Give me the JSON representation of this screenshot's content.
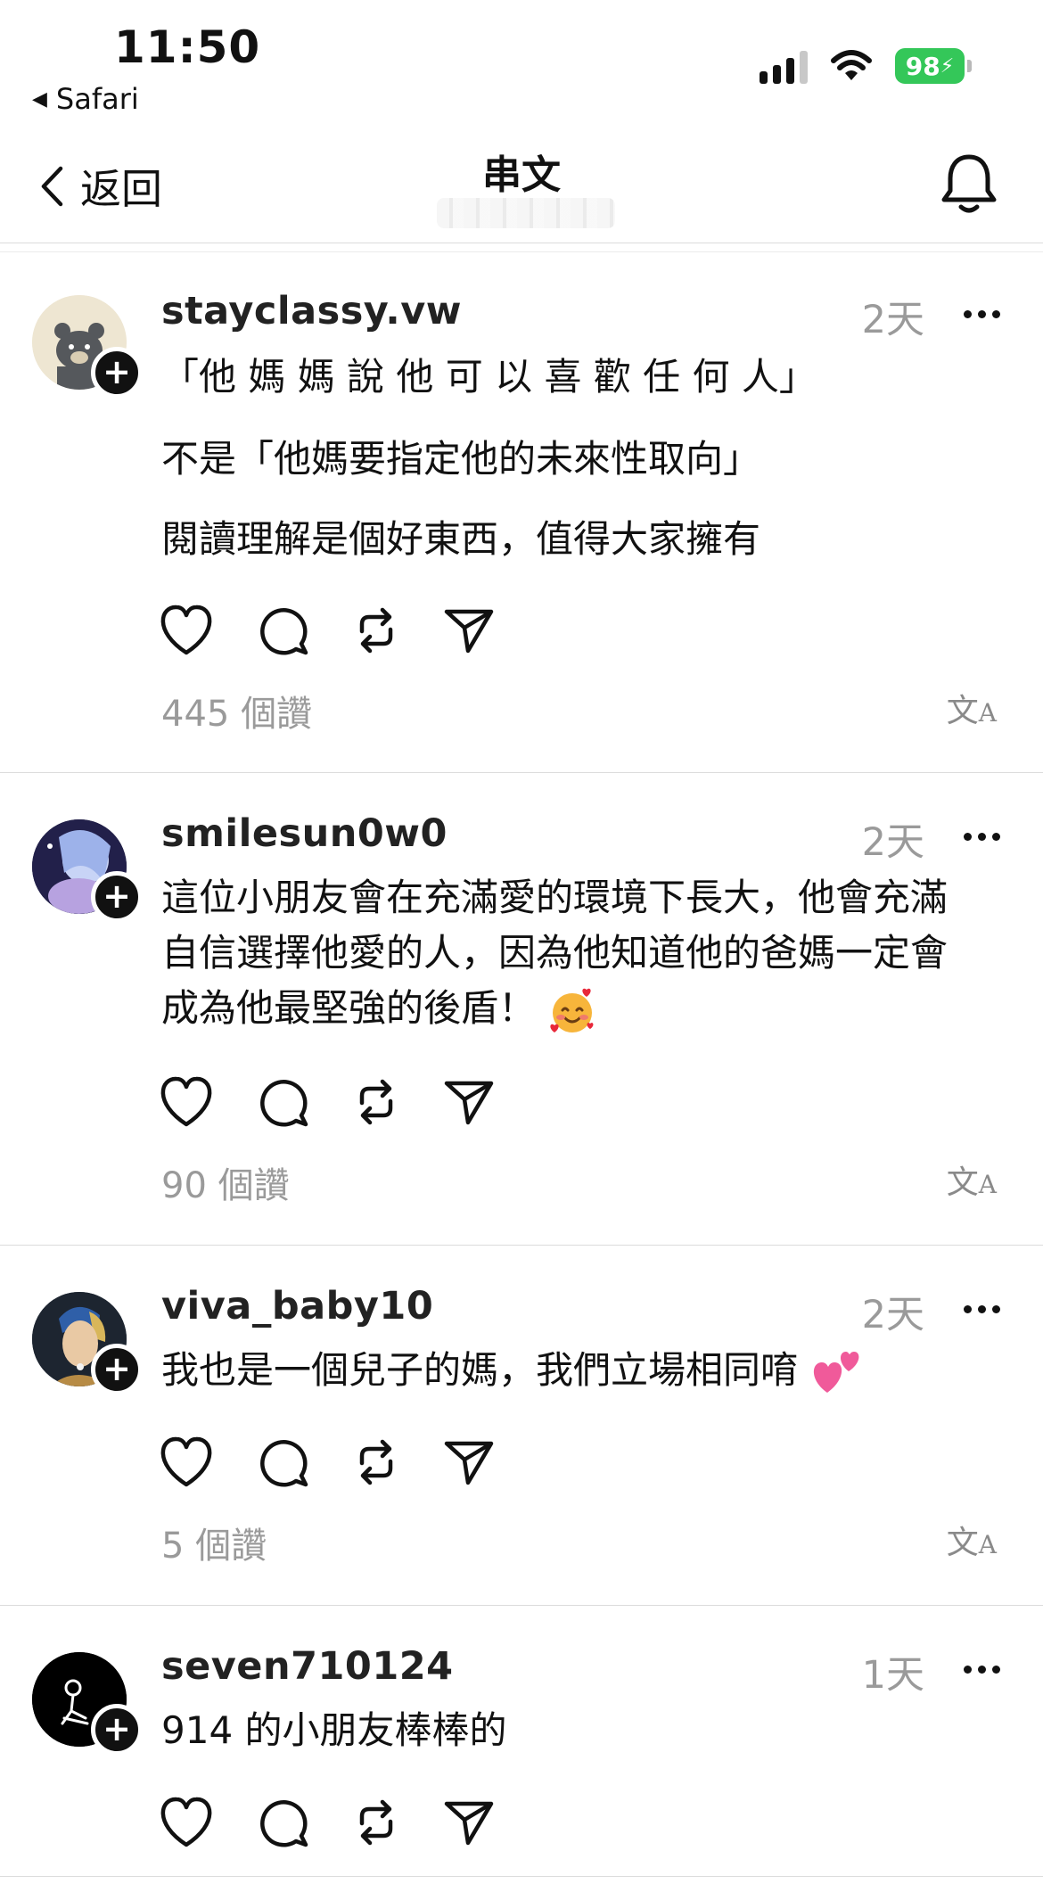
{
  "status_bar": {
    "time": "11:50",
    "back_app": "Safari",
    "battery": "98"
  },
  "nav": {
    "back_label": "返回",
    "title": "串文"
  },
  "posts": [
    {
      "username": "stayclassy.vw",
      "time": "2天",
      "lines": [
        "「他 媽 媽 說 他 可 以 喜 歡 任 何 人」",
        "不是「他媽要指定他的未來性取向」",
        "閱讀理解是個好東西，值得大家擁有"
      ],
      "likes": "445 個讚"
    },
    {
      "username": "smilesun0w0",
      "time": "2天",
      "lines": [
        "這位小朋友會在充滿愛的環境下長大，他會充滿",
        "自信選擇他愛的人，因為他知道他的爸媽一定會",
        "成為他最堅強的後盾！"
      ],
      "likes": "90 個讚"
    },
    {
      "username": "viva_baby10",
      "time": "2天",
      "lines": [
        "我也是一個兒子的媽，我們立場相同唷"
      ],
      "likes": "5 個讚"
    },
    {
      "username": "seven710124",
      "time": "1天",
      "lines": [
        "914 的小朋友棒棒的"
      ],
      "likes": ""
    }
  ],
  "icons": [
    "back-chevron-icon",
    "bell-icon",
    "heart-icon",
    "comment-icon",
    "repost-icon",
    "share-icon",
    "translate-icon",
    "more-icon"
  ],
  "colors": {
    "text": "#111111",
    "muted": "#9a9a9a",
    "battery": "#34c759",
    "divider": "#dcdcdc"
  }
}
